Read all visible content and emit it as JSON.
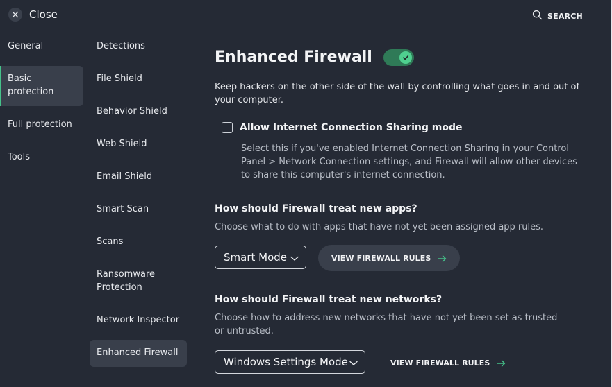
{
  "topbar": {
    "close_label": "Close",
    "search_label": "SEARCH"
  },
  "nav": {
    "items": [
      {
        "label": "General"
      },
      {
        "label": "Basic protection",
        "active": true
      },
      {
        "label": "Full protection"
      },
      {
        "label": "Tools"
      }
    ]
  },
  "subnav": {
    "items": [
      {
        "label": "Detections"
      },
      {
        "label": "File Shield"
      },
      {
        "label": "Behavior Shield"
      },
      {
        "label": "Web Shield"
      },
      {
        "label": "Email Shield"
      },
      {
        "label": "Smart Scan"
      },
      {
        "label": "Scans"
      },
      {
        "label": "Ransomware Protection"
      },
      {
        "label": "Network Inspector"
      },
      {
        "label": "Enhanced Firewall",
        "active": true
      }
    ]
  },
  "main": {
    "title": "Enhanced Firewall",
    "toggle_on": true,
    "description": "Keep hackers on the other side of the wall by controlling what goes in and out of your computer.",
    "ics": {
      "checked": false,
      "label": "Allow Internet Connection Sharing mode",
      "description": "Select this if you've enabled Internet Connection Sharing in your Control Panel > Network Connection settings, and Firewall will allow other devices to share this computer's internet connection."
    },
    "apps_section": {
      "title": "How should Firewall treat new apps?",
      "description": "Choose what to do with apps that have not yet been assigned app rules.",
      "select_value": "Smart Mode",
      "button_label": "VIEW FIREWALL RULES"
    },
    "networks_section": {
      "title": "How should Firewall treat new networks?",
      "description": "Choose how to address new networks that have not yet been set as trusted or untrusted.",
      "select_value": "Windows Settings Mode",
      "button_label": "VIEW FIREWALL RULES"
    }
  },
  "colors": {
    "background": "#252a35",
    "active_item": "#393f4b",
    "accent_green": "#45c28a",
    "toggle_track": "#2f7a57"
  }
}
